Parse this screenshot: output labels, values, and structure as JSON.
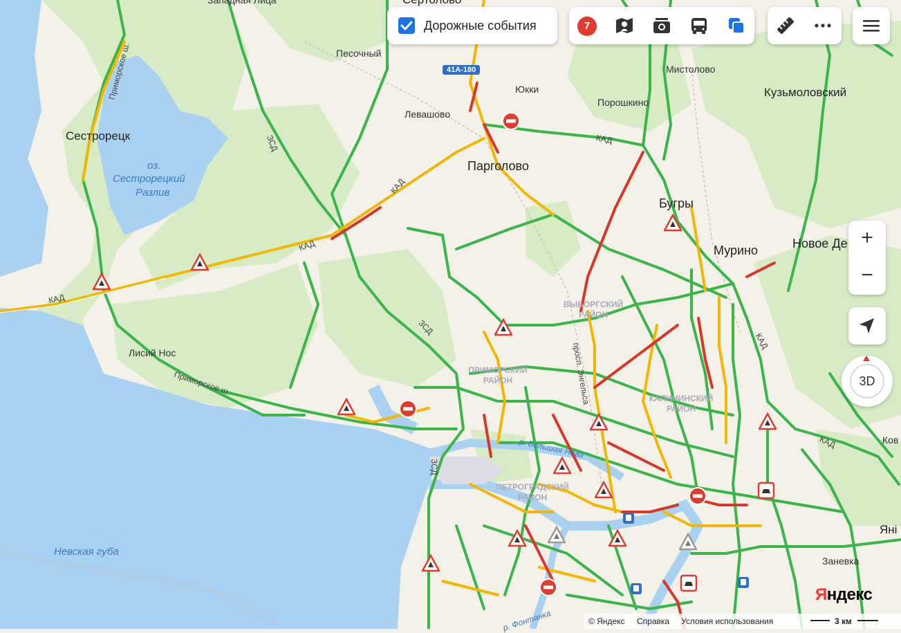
{
  "map": {
    "places": {
      "sertolovo": "Сертолово",
      "zapadnaya_litsa": "Западная Лица",
      "pesochny": "Песочный",
      "levashovo": "Левашово",
      "yukki": "Юкки",
      "mistolovo": "Мистолово",
      "kuzmolovsky": "Кузьмоловский",
      "poroshkino": "Порошкино",
      "sestroretsk": "Сестрорецк",
      "pargolovo": "Парголово",
      "bugry": "Бугры",
      "murino": "Мурино",
      "novoe_devyatkino": "Новое Де",
      "lisy_nos": "Лисий Нос",
      "zanevka": "Заневка",
      "kov": "Ков",
      "yani": "Янi"
    },
    "water": {
      "lake_line1": "оз.",
      "lake_line2": "Сестрорецкий",
      "lake_line3": "Разлив",
      "neva_bay": "Невская губа",
      "bolshaya_neva": "р. Большая Нева",
      "fontanka": "р. Фонтанка"
    },
    "districts": {
      "vyborgsky": "Выборгский район",
      "primorsky": "Приморский район",
      "kalininsky": "Калининский район",
      "petrogradsky": "Петроградский район"
    },
    "roads": {
      "kad": "КАД",
      "zsd": "ЗСД",
      "primorskoe_sh": "Приморское ш.",
      "engelsa": "просп. Энгельса",
      "route_shield": "41А-180"
    }
  },
  "controls": {
    "traffic_events_label": "Дорожные события",
    "traffic_events_checked": true,
    "events_count": "7",
    "layers": [
      "panorama-icon",
      "camera-icon",
      "bus-icon",
      "layers-icon"
    ],
    "zoom_in": "+",
    "zoom_out": "−",
    "compass_label": "3D"
  },
  "footer": {
    "copyright": "© Яндекс",
    "help": "Справка",
    "terms": "Условия использования",
    "scale": "3 км",
    "logo_ya": "Я",
    "logo_rest": "ндекс"
  },
  "colors": {
    "accent": "#1a73e8",
    "traffic_free": "#39b54a",
    "traffic_medium": "#f2b705",
    "traffic_jam": "#d8362b",
    "water": "#a9d2f2",
    "land": "#f4f1e8",
    "forest": "#d7ecc5"
  }
}
